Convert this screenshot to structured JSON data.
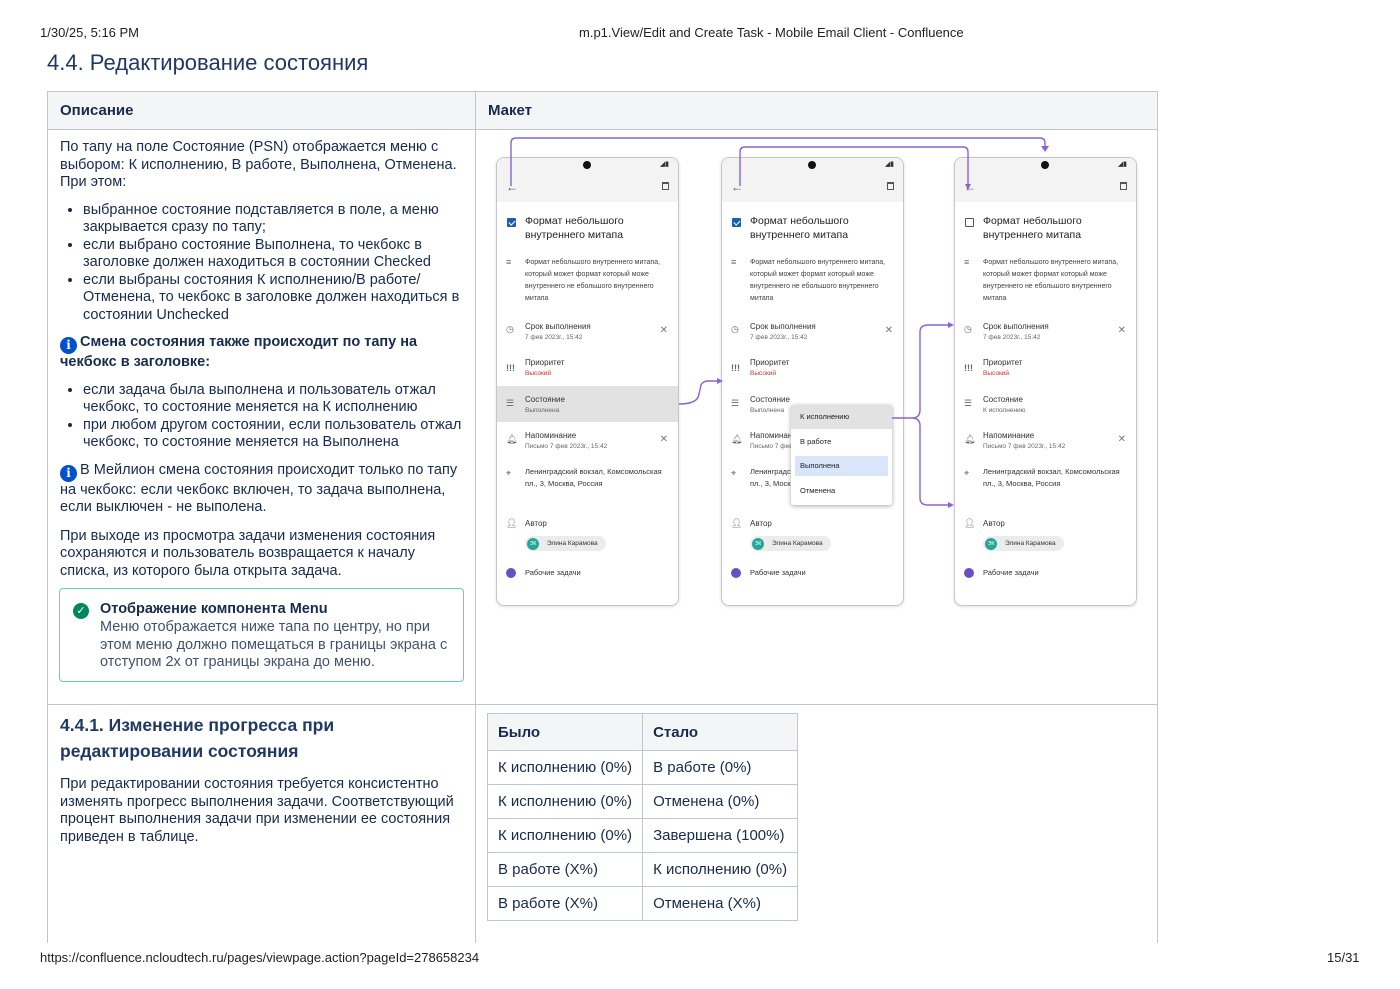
{
  "header": {
    "datetime": "1/30/25, 5:16 PM",
    "title": "m.p1.View/Edit and Create Task - Mobile Email Client - Confluence"
  },
  "footer": {
    "url": "https://confluence.ncloudtech.ru/pages/viewpage.action?pageId=278658234",
    "page": "15/31"
  },
  "section_title": "4.4.  Редактирование состояния",
  "table_headers": {
    "description": "Описание",
    "mockup": "Макет"
  },
  "description": {
    "intro": "По тапу на поле Состояние (PSN) отображается меню с выбором: К исполнению, В работе, Выполнена, Отменена. При этом:",
    "bullets1": [
      "выбранное состояние подставляется в поле, а меню закрывается сразу по тапу;",
      "если выбрано состояние Выполнена, то чекбокс в заголовке должен находиться в состоянии Checked",
      "если выбраны состояния К исполнению/В работе/ Отменена, то чекбокс в заголовке должен находиться в состоянии Unchecked"
    ],
    "info1": "Смена состояния также происходит по тапу на чекбокс в заголовке:",
    "bullets2": [
      "если задача была выполнена и пользователь отжал чекбокс, то состояние меняется на К исполнению",
      "при любом другом состоянии, если пользователь отжал чекбокс, то состояние меняется на Выполнена"
    ],
    "info2": "В Мейлион смена состояния происходит только по тапу на чекбокс: если чекбокс включен, то задача выполнена, если выключен - не выполена.",
    "exit_para": "При выходе из просмотра задачи изменения состояния сохраняются и пользователь возвращается к началу списка, из которого была открыта задача.",
    "success_title": "Отображение компонента Menu",
    "success_body": "Меню отображается ниже тапа по центру, но при этом меню должно помещаться в границы экрана с отступом 2х от границы экрана до меню."
  },
  "mockup": {
    "task_title": "Формат небольшого внутреннего митапа",
    "task_description": "Формат небольшого внутреннего митапа, который может формат который може  внутреннего не ебольшого внутреннего митапа",
    "deadline_label": "Срок выполнения",
    "deadline_value": "7 фев 2023г., 15:42",
    "priority_label": "Приоритет",
    "priority_value": "Высокий",
    "status_label": "Состояние",
    "status_values": [
      "Выполнена",
      "Выполнена",
      "К исполнению"
    ],
    "reminder_label": "Напоминание",
    "reminder_value": "Письмо 7 фев 2023г., 15:42",
    "address": "Ленинградский вокзал, Комсомольская пл., 3, Москва, Россия",
    "author_label": "Автор",
    "author_initials": "ЭК",
    "author_name": "Элина Карамова",
    "folder": "Рабочие задачи",
    "menu_items": [
      "К исполнению",
      "В работе",
      "Выполнена",
      "Отменена"
    ],
    "checkbox_checked": [
      true,
      true,
      false
    ]
  },
  "subsection": {
    "title": "4.4.1.  Изменение прогресса при редактировании состояния",
    "text": "При редактировании состояния требуется консистентно изменять прогресс выполнения задачи. Соответствующий процент выполнения задачи при изменении ее состояния приведен в таблице."
  },
  "status_table": {
    "headers": [
      "Было",
      "Стало"
    ],
    "rows": [
      [
        "К исполнению (0%)",
        "В работе (0%)"
      ],
      [
        "К исполнению (0%)",
        "Отменена (0%)"
      ],
      [
        "К исполнению (0%)",
        "Завершена (100%)"
      ],
      [
        "В работе (X%)",
        "К исполнению (0%)"
      ],
      [
        "В работе (X%)",
        "Отменена (X%)"
      ]
    ]
  },
  "colors": {
    "accent_arrow": "#8a63d2",
    "info": "#0052cc",
    "success": "#00875a",
    "heading": "#1f3864"
  }
}
